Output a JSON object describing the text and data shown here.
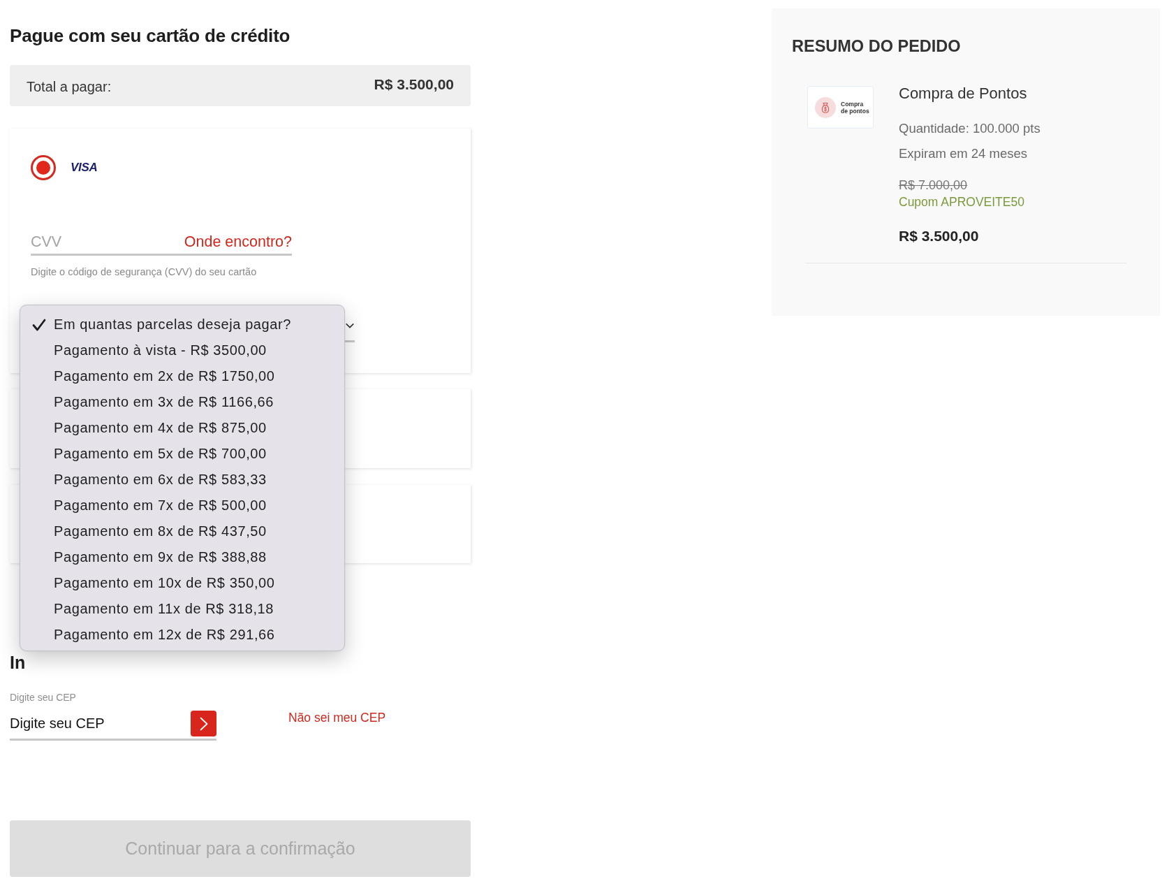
{
  "heading": "Pague com seu cartão de crédito",
  "total": {
    "label": "Total a pagar:",
    "amount": "R$ 3.500,00"
  },
  "payment_methods": [
    {
      "brand": "VISA",
      "selected": true
    }
  ],
  "cvv": {
    "placeholder": "CVV",
    "help_link": "Onde encontro?",
    "hint": "Digite o código de segurança (CVV) do seu cartão"
  },
  "installments": {
    "options": [
      {
        "label": "Em quantas parcelas deseja pagar?",
        "selected": true
      },
      {
        "label": "Pagamento à vista - R$ 3500,00",
        "selected": false
      },
      {
        "label": "Pagamento em 2x de R$ 1750,00",
        "selected": false
      },
      {
        "label": "Pagamento em 3x de R$ 1166,66",
        "selected": false
      },
      {
        "label": "Pagamento em 4x de R$ 875,00",
        "selected": false
      },
      {
        "label": "Pagamento em 5x de R$ 700,00",
        "selected": false
      },
      {
        "label": "Pagamento em 6x de R$ 583,33",
        "selected": false
      },
      {
        "label": "Pagamento em 7x de R$ 500,00",
        "selected": false
      },
      {
        "label": "Pagamento em 8x de R$ 437,50",
        "selected": false
      },
      {
        "label": "Pagamento em 9x de R$ 388,88",
        "selected": false
      },
      {
        "label": "Pagamento em 10x de R$ 350,00",
        "selected": false
      },
      {
        "label": "Pagamento em 11x de R$ 318,18",
        "selected": false
      },
      {
        "label": "Pagamento em 12x de R$ 291,66",
        "selected": false
      }
    ]
  },
  "billing": {
    "heading": "In",
    "cep_label": "Digite seu CEP",
    "cep_placeholder": "Digite seu CEP",
    "unknown_cep_link": "Não sei meu CEP"
  },
  "continue_button": {
    "label": "Continuar para a confirmação",
    "disabled": true
  },
  "order_summary": {
    "title": "RESUMO DO PEDIDO",
    "items": [
      {
        "thumbnail_caption": "Compra de pontos",
        "name": "Compra de Pontos",
        "quantity": "Quantidade: 100.000 pts",
        "expiry": "Expiram em 24 meses",
        "original_price": "R$ 7.000,00",
        "coupon": "Cupom APROVEITE50",
        "price": "R$ 3.500,00"
      }
    ]
  }
}
